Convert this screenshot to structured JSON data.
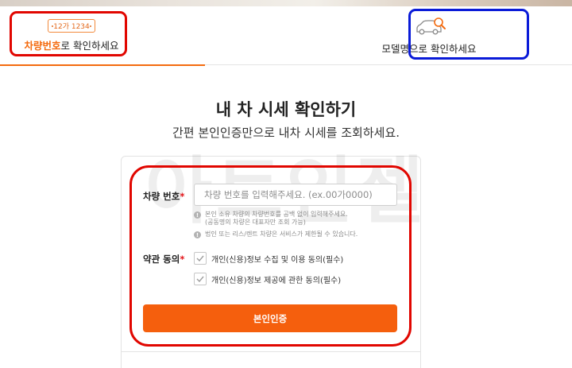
{
  "tabs": {
    "plate": {
      "plate_sample": "12가 1234",
      "label_accent": "차량번호",
      "label_rest": "로 확인하세요"
    },
    "model": {
      "icon": "car-search-icon",
      "label": "모델명으로 확인하세요"
    }
  },
  "heading": {
    "title": "내 차 시세 확인하기",
    "subtitle": "간편 본인인증만으로 내차 시세를 조회하세요."
  },
  "watermark": "아트인젤",
  "form": {
    "plate_label": "차량 번호",
    "required_mark": "*",
    "plate_placeholder": "차량 번호를 입력해주세요. (ex.00가0000)",
    "notes": [
      "본인 소유 차량의 차량번호를 공백 없이 입력해주세요.",
      "(공동명의 차량은 대표자만 조회 가능)",
      "법인 또는 리스/렌트 차량은 서비스가 제한될 수 있습니다."
    ],
    "terms_label": "약관 동의",
    "agreements": [
      "개인(신용)정보 수집 및 이용 동의(필수)",
      "개인(신용)정보 제공에 관한 동의(필수)"
    ],
    "submit_label": "본인인증"
  },
  "colors": {
    "accent": "#f46b0f",
    "button": "#f55f0d",
    "highlight_red": "#e10600",
    "highlight_blue": "#0a1bd8"
  }
}
